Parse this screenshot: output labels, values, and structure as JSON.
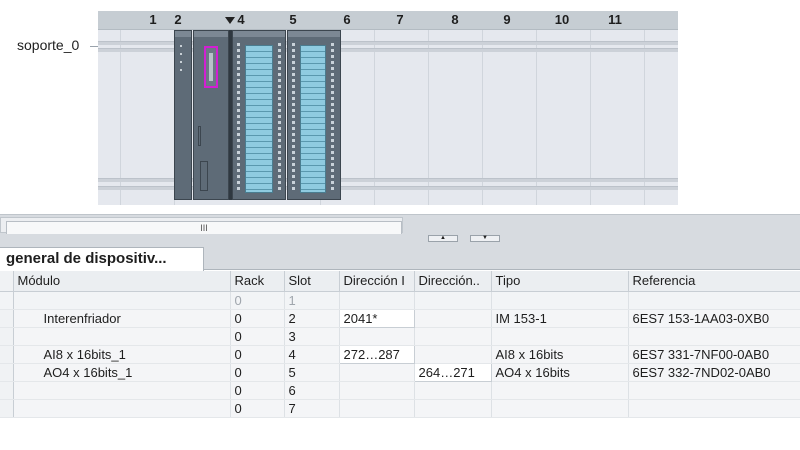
{
  "device_view": {
    "slot_numbers": [
      "1",
      "2",
      "4",
      "5",
      "6",
      "7",
      "8",
      "9",
      "10",
      "11"
    ],
    "rack_label": "soporte_0",
    "scroll_thumb_glyph": "III",
    "split_up_glyph": "▲",
    "split_down_glyph": "▼",
    "accent_color": "#d21fd3"
  },
  "overview": {
    "tab_label": "general de dispositiv..."
  },
  "table": {
    "columns": [
      "Módulo",
      "Rack",
      "Slot",
      "Dirección I",
      "Dirección..",
      "Tipo",
      "Referencia"
    ],
    "rows": [
      {
        "modulo": "",
        "rack": "0",
        "slot": "1",
        "dir_i": "",
        "dir_q": "",
        "tipo": "",
        "referencia": ""
      },
      {
        "modulo": "Interenfriador",
        "rack": "0",
        "slot": "2",
        "dir_i": "2041*",
        "dir_q": "",
        "tipo": "IM 153-1",
        "referencia": "6ES7 153-1AA03-0XB0"
      },
      {
        "modulo": "",
        "rack": "0",
        "slot": "3",
        "dir_i": "",
        "dir_q": "",
        "tipo": "",
        "referencia": ""
      },
      {
        "modulo": "AI8 x 16bits_1",
        "rack": "0",
        "slot": "4",
        "dir_i": "272…287",
        "dir_q": "",
        "tipo": "AI8 x 16bits",
        "referencia": "6ES7 331-7NF00-0AB0"
      },
      {
        "modulo": "AO4 x 16bits_1",
        "rack": "0",
        "slot": "5",
        "dir_i": "",
        "dir_q": "264…271",
        "tipo": "AO4 x 16bits",
        "referencia": "6ES7 332-7ND02-0AB0"
      },
      {
        "modulo": "",
        "rack": "0",
        "slot": "6",
        "dir_i": "",
        "dir_q": "",
        "tipo": "",
        "referencia": ""
      },
      {
        "modulo": "",
        "rack": "0",
        "slot": "7",
        "dir_i": "",
        "dir_q": "",
        "tipo": "",
        "referencia": ""
      }
    ]
  }
}
